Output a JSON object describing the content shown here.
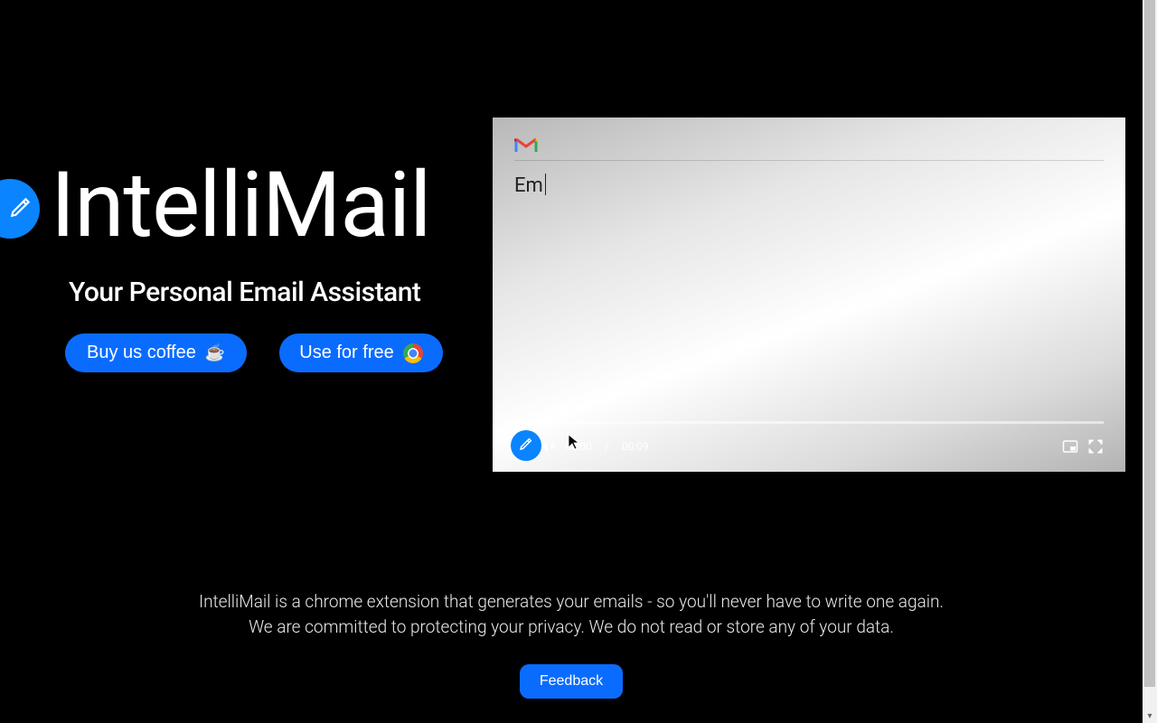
{
  "hero": {
    "title": "IntelliMail",
    "subtitle": "Your Personal Email Assistant",
    "coffee_label": "Buy us coffee",
    "free_label": "Use for free"
  },
  "compose": {
    "typed_text": "Em"
  },
  "video": {
    "current_time": "00:00",
    "duration": "00:09",
    "separator": "/"
  },
  "footer": {
    "line1": "IntelliMail is a chrome extension that generates your emails - so you'll never have to write one again.",
    "line2": "We are committed to protecting your privacy. We do not read or store any of your data.",
    "feedback_label": "Feedback"
  }
}
